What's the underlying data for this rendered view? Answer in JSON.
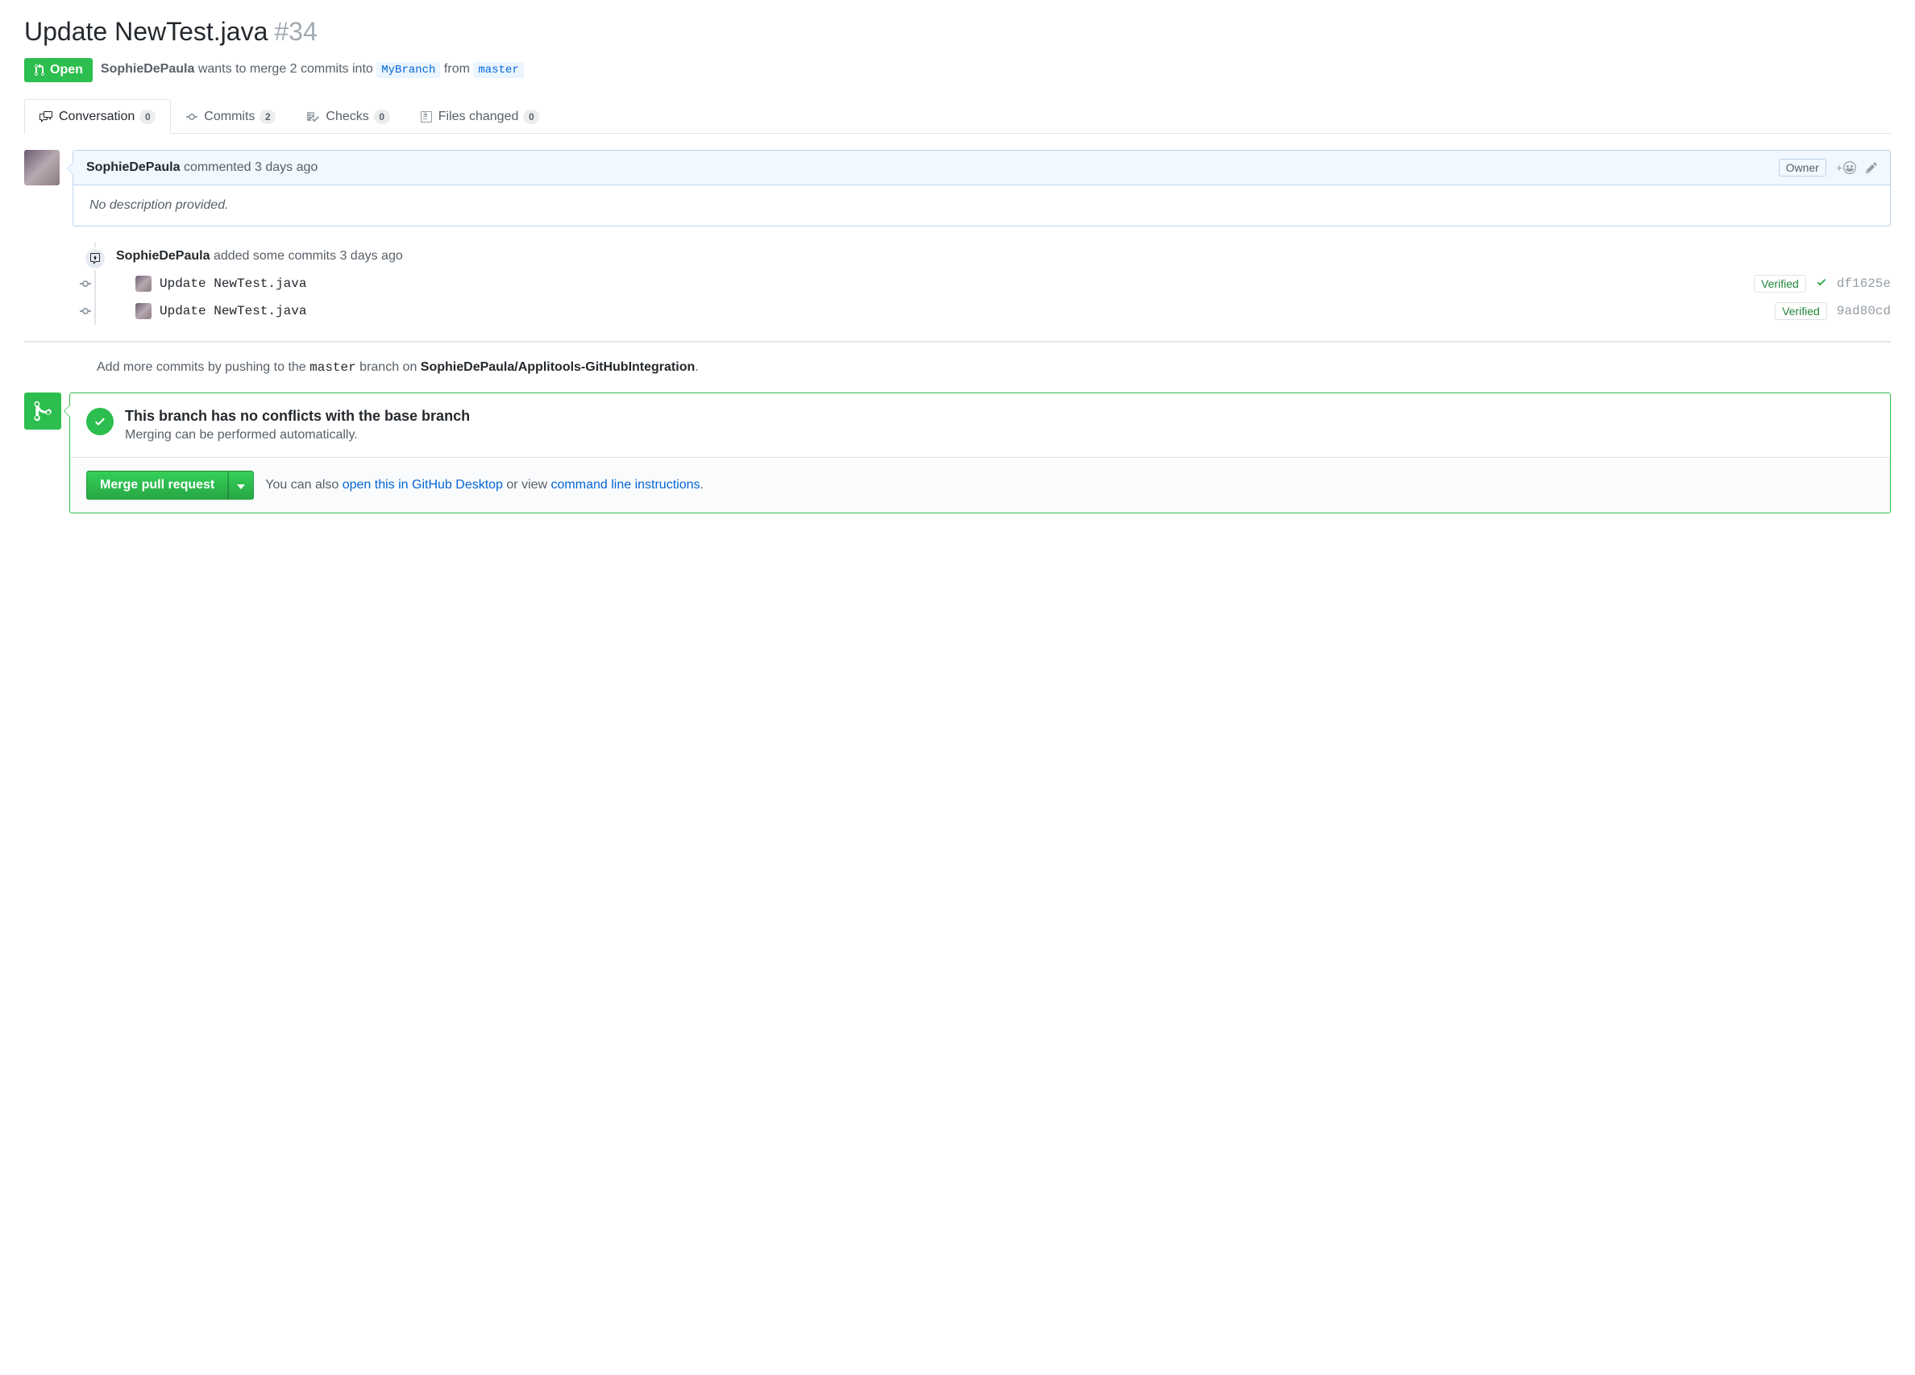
{
  "pr": {
    "title": "Update NewTest.java",
    "number": "#34"
  },
  "state": "Open",
  "meta": {
    "author": "SophieDePaula",
    "wants": "wants to merge 2 commits into",
    "base_branch": "MyBranch",
    "from_word": "from",
    "head_branch": "master"
  },
  "tabs": {
    "conversation": {
      "label": "Conversation",
      "count": "0"
    },
    "commits": {
      "label": "Commits",
      "count": "2"
    },
    "checks": {
      "label": "Checks",
      "count": "0"
    },
    "files": {
      "label": "Files changed",
      "count": "0"
    }
  },
  "comment": {
    "author": "SophieDePaula",
    "verb": "commented",
    "time": "3 days ago",
    "owner_label": "Owner",
    "body": "No description provided."
  },
  "timeline": {
    "author": "SophieDePaula",
    "text": "added some commits",
    "time": "3 days ago",
    "commits": [
      {
        "msg": "Update NewTest.java",
        "verified": "Verified",
        "sha": "df1625e",
        "has_check": true
      },
      {
        "msg": "Update NewTest.java",
        "verified": "Verified",
        "sha": "9ad80cd",
        "has_check": false
      }
    ]
  },
  "push_hint": {
    "pre": "Add more commits by pushing to the ",
    "branch": "master",
    "mid": " branch on ",
    "repo": "SophieDePaula/Applitools-GitHubIntegration",
    "period": "."
  },
  "merge": {
    "title": "This branch has no conflicts with the base branch",
    "subtitle": "Merging can be performed automatically.",
    "button": "Merge pull request",
    "alt_pre": "You can also ",
    "alt_link1": "open this in GitHub Desktop",
    "alt_mid": " or view ",
    "alt_link2": "command line instructions",
    "alt_post": "."
  }
}
